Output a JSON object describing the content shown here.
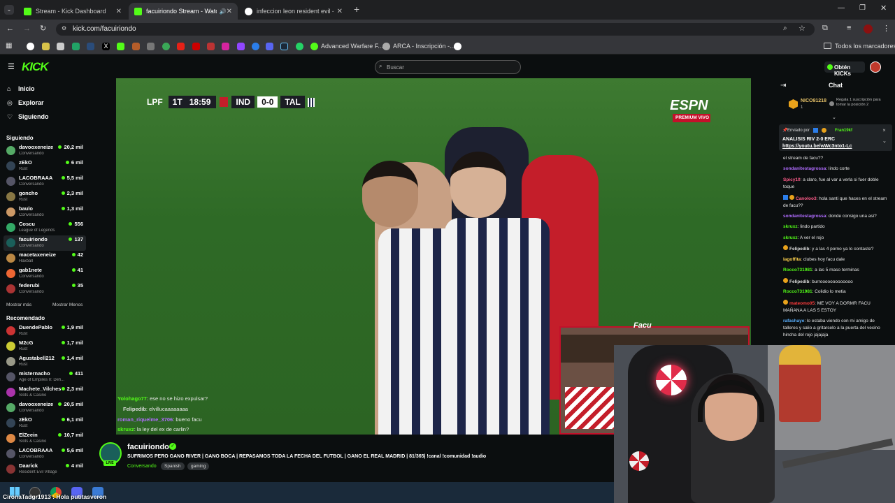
{
  "browser": {
    "tabs": [
      {
        "title": "Stream - Kick Dashboard",
        "icon": "kick-icon",
        "active": false
      },
      {
        "title": "facuiriondo Stream - Watch",
        "icon": "kick-icon",
        "active": true
      },
      {
        "title": "infeccion leon resident evil - Bu",
        "icon": "google-icon",
        "active": false
      }
    ],
    "url": "kick.com/facuiriondo",
    "bookmarks": [
      {
        "label": "Advanced Warfare F..."
      },
      {
        "label": "ARCA - Inscripción -..."
      }
    ],
    "all_bookmarks": "Todos los marcadores"
  },
  "header": {
    "logo": "KICK",
    "search_placeholder": "Buscar",
    "kicks_button": "Obtén KICKs"
  },
  "sidebar": {
    "nav": [
      {
        "label": "Inicio",
        "icon": "home-icon"
      },
      {
        "label": "Explorar",
        "icon": "compass-icon"
      },
      {
        "label": "Siguiendo",
        "icon": "heart-icon"
      }
    ],
    "following_title": "Siguiendo",
    "following": [
      {
        "name": "davooxeneize",
        "game": "Conversando",
        "viewers": "20,2 mil"
      },
      {
        "name": "zEkO",
        "game": "Rust",
        "viewers": "6 mil"
      },
      {
        "name": "LACOBRAAA",
        "game": "Conversando",
        "viewers": "5,5 mil"
      },
      {
        "name": "goncho",
        "game": "Rust",
        "viewers": "2,3 mil"
      },
      {
        "name": "baulo",
        "game": "Conversando",
        "viewers": "1,3 mil"
      },
      {
        "name": "Coscu",
        "game": "League of Legends",
        "viewers": "556"
      },
      {
        "name": "facuiriondo",
        "game": "Conversando",
        "viewers": "137"
      },
      {
        "name": "macetaxeneize",
        "game": "Haxball",
        "viewers": "42"
      },
      {
        "name": "gab1nete",
        "game": "Conversando",
        "viewers": "41"
      },
      {
        "name": "federubi",
        "game": "Conversando",
        "viewers": "35"
      }
    ],
    "show_more": "Mostrar más",
    "show_less": "Mostrar Menos",
    "recommended_title": "Recomendado",
    "recommended": [
      {
        "name": "DuendePablo",
        "game": "Rust",
        "viewers": "1,9 mil"
      },
      {
        "name": "M2cG",
        "game": "Rust",
        "viewers": "1,7 mil"
      },
      {
        "name": "Agustabell212",
        "game": "Rust",
        "viewers": "1,4 mil"
      },
      {
        "name": "misternacho",
        "game": "Age of Empires II: Defi...",
        "viewers": "411"
      },
      {
        "name": "Machete_Vilches",
        "game": "Slots & Casino",
        "viewers": "2,3 mil"
      },
      {
        "name": "davooxeneize",
        "game": "Conversando",
        "viewers": "20,5 mil"
      },
      {
        "name": "zEkO",
        "game": "Rust",
        "viewers": "6,1 mil"
      },
      {
        "name": "ElZeein",
        "game": "Slots & Casino",
        "viewers": "10,7 mil"
      },
      {
        "name": "LACOBRAAA",
        "game": "Conversando",
        "viewers": "5,6 mil"
      },
      {
        "name": "Daarick",
        "game": "Resident Evil Village",
        "viewers": "4 mil"
      }
    ]
  },
  "video": {
    "league": "LPF",
    "half": "1T",
    "clock": "18:59",
    "home": "IND",
    "score": "0-0",
    "away": "TAL",
    "broadcaster": "ESPN",
    "broadcaster_sub": "PREMIUM VIVO",
    "cam_label": "Facu",
    "overlay_chat": [
      {
        "user": "Yolohago77",
        "text": ": ese no se hizo expulsar?",
        "color": "#53fc18"
      },
      {
        "user": "Felipedib",
        "text": ": elvillucaaaaaaaa",
        "color": "#dddddd"
      },
      {
        "user": "roman_riquelme_3706",
        "text": ": bueno facu",
        "color": "#b06cff"
      },
      {
        "user": "skruxz",
        "text": ": la ley del ex de carlin?",
        "color": "#53fc18"
      }
    ]
  },
  "chat": {
    "title": "Chat",
    "top_gifter": "NICO91218",
    "top_gifter_count": "1",
    "gift_cta": "Regala 1 suscripción para tomar la posición 2",
    "pinned": {
      "sent_by": "Enviado por",
      "sender": "Fran19kf",
      "title": "ANALISIS RIV 2-0 ERC",
      "link": "https://youtu.be/wWc3nto1-Lc"
    },
    "messages": [
      {
        "user": "",
        "text": "el stream de facu??",
        "color": "#dddddd"
      },
      {
        "user": "sondanitestagrossa",
        "text": ": lindo corte",
        "color": "#b06cff"
      },
      {
        "user": "Spicy10",
        "text": ": a claro, fue al var a verla si fuer doble toque",
        "color": "#ff5c8a"
      },
      {
        "user": "Canoloo3",
        "text": ": hola santi que haces en el stream de facu??",
        "color": "#ff5c8a"
      },
      {
        "user": "sondanitestagrossa",
        "text": ": donde consigo una asi?",
        "color": "#b06cff"
      },
      {
        "user": "skruxz",
        "text": ": lindo partido",
        "color": "#53fc18"
      },
      {
        "user": "skruxz",
        "text": ": A ver el rojo",
        "color": "#53fc18"
      },
      {
        "user": "Felipedib",
        "text": ": y a las 4 porno ya lo contaste?",
        "color": "#dddddd"
      },
      {
        "user": "lagoffita",
        "text": ": clubes hoy facu dale",
        "color": "#ffd34e"
      },
      {
        "user": "Rocco731981",
        "text": ": a las 5 maso terminas",
        "color": "#53fc18"
      },
      {
        "user": "Felipedib",
        "text": ": burrooooooooooooo",
        "color": "#dddddd"
      },
      {
        "user": "Rocco731981",
        "text": ": Colidio lo metia",
        "color": "#53fc18"
      },
      {
        "user": "mateomo05",
        "text": ": ME VOY A DORMR FACU MAÑANA A LAS 5 ESTOY",
        "color": "#ff3b3b"
      },
      {
        "user": "rafashaye",
        "text": ": lo estaba viendo con mi amigo de talleres y salio a gritarselo a la puerta del vecino hincha del rojo jajajaja",
        "color": "#5ab0ff"
      }
    ]
  },
  "stream": {
    "name": "facuiriondo",
    "live": "LIVE",
    "title": "SUFRIMOS PERO GANO RIVER | GANO BOCA | REPASAMOS TODA LA FECHA DEL FUTBOL | GANO EL REAL MADRID | 81/365| !canal !comunidad !audio",
    "category": "Conversando",
    "tags": [
      "Spanish",
      "gaming"
    ]
  },
  "taskbar": {
    "overlay_text": "CironaTadgr1913 : Hola putitasveron"
  },
  "colors": {
    "kick_green": "#53fc18",
    "espn_red": "#c4102a"
  }
}
